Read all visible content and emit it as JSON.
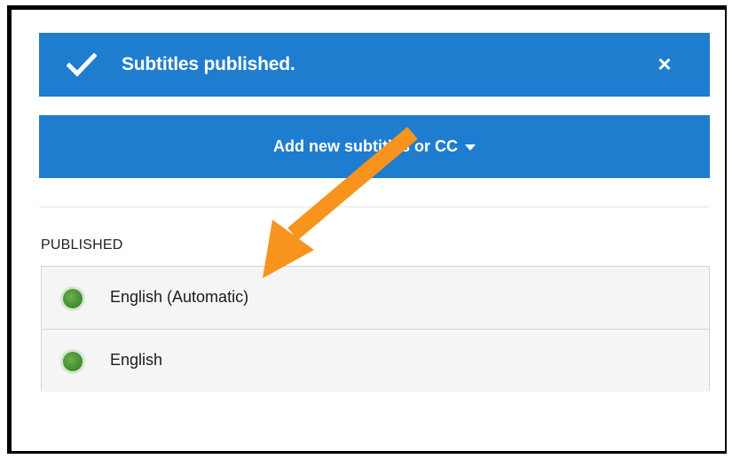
{
  "toast": {
    "message": "Subtitles published.",
    "close_label": "×",
    "icon": "check-icon",
    "color": "#1f7dd0"
  },
  "add_button": {
    "label": "Add new subtitles or CC",
    "icon": "caret-down-icon"
  },
  "published": {
    "title": "PUBLISHED",
    "items": [
      {
        "label": "English (Automatic)",
        "status_icon": "green-dot-icon"
      },
      {
        "label": "English",
        "status_icon": "green-dot-icon"
      }
    ]
  },
  "annotation": {
    "icon": "arrow-icon",
    "color": "#f7941d"
  }
}
